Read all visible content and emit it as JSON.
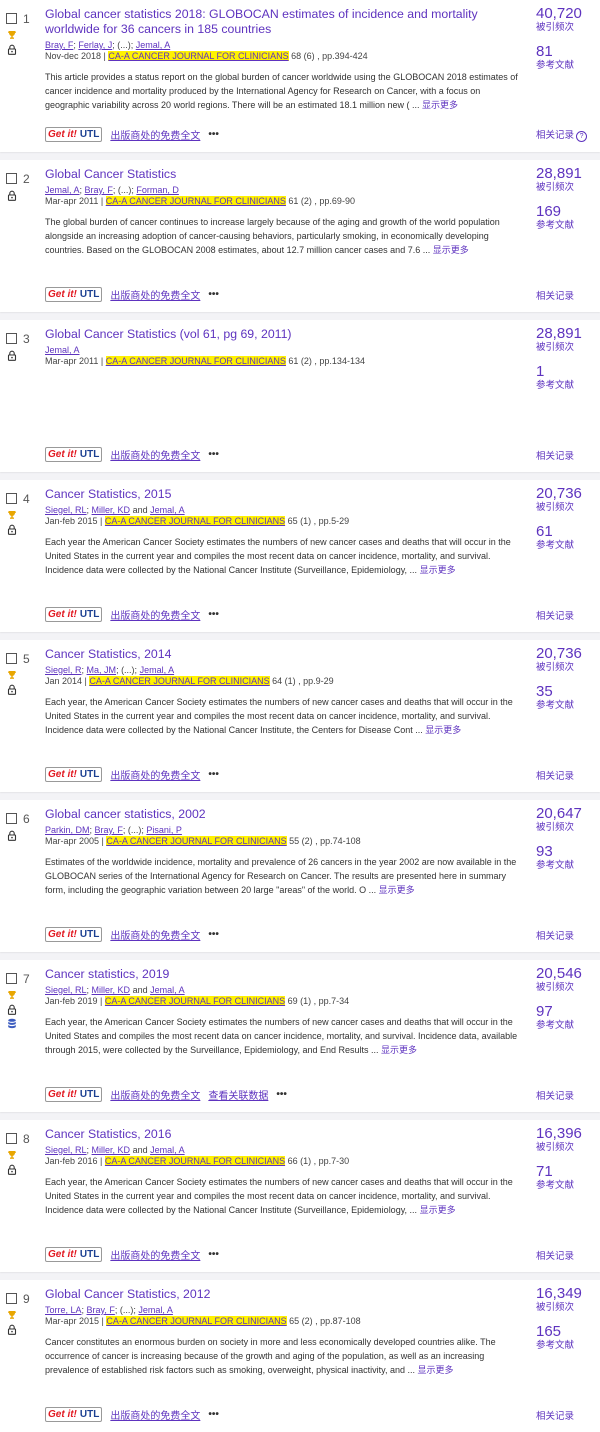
{
  "ui": {
    "more_label": "显示更多",
    "getit_g": "Get it!",
    "getit_u": "UTL",
    "fulltext_label": "出版商处的免费全文",
    "dataset_label": "查看关联数据",
    "dots": "•••",
    "cited_label": "被引频次",
    "refs_label": "参考文献",
    "related_label": "相关记录",
    "help_icon_text": "?",
    "icons": {
      "award": "trophy-icon",
      "lock": "lock-icon",
      "data": "database-icon"
    },
    "colors": {
      "link": "#5e33bf",
      "highlight": "#fff200",
      "getit_red": "#e21a22",
      "getit_blue": "#1b3f91"
    }
  },
  "records": [
    {
      "n": "1",
      "trophy": true,
      "lock": true,
      "db": false,
      "title": "Global cancer statistics 2018: GLOBOCAN estimates of incidence and mortality worldwide for 36 cancers in 185 countries",
      "authors": [
        {
          "t": "Bray, F",
          "link": true
        },
        {
          "t": "; ",
          "link": false
        },
        {
          "t": "Ferlay, J",
          "link": true
        },
        {
          "t": "; (...); ",
          "link": false
        },
        {
          "t": "Jemal, A",
          "link": true
        }
      ],
      "date": "Nov-dec 2018 | ",
      "journal": "CA-A CANCER JOURNAL FOR CLINICIANS",
      "issue": " 68 (6) , pp.394-424",
      "abstract": "This article provides a status report on the global burden of cancer worldwide using the GLOBOCAN 2018 estimates of cancer incidence and mortality produced by the International Agency for Research on Cancer, with a focus on geographic variability across 20 world regions. There will be an estimated 18.1 million new ( ...",
      "cited": "40,720",
      "refs": "81",
      "help": true,
      "dataset": false
    },
    {
      "n": "2",
      "trophy": false,
      "lock": true,
      "db": false,
      "title": "Global Cancer Statistics",
      "authors": [
        {
          "t": "Jemal, A",
          "link": true
        },
        {
          "t": "; ",
          "link": false
        },
        {
          "t": "Bray, F",
          "link": true
        },
        {
          "t": "; (...); ",
          "link": false
        },
        {
          "t": "Forman, D",
          "link": true
        }
      ],
      "date": "Mar-apr 2011 | ",
      "journal": "CA-A CANCER JOURNAL FOR CLINICIANS",
      "issue": " 61 (2) , pp.69-90",
      "abstract": "The global burden of cancer continues to increase largely because of the aging and growth of the world population alongside an increasing adoption of cancer-causing behaviors, particularly smoking, in economically developing countries. Based on the GLOBOCAN 2008 estimates, about 12.7 million cancer cases and 7.6 ...",
      "cited": "28,891",
      "refs": "169",
      "help": false,
      "dataset": false
    },
    {
      "n": "3",
      "trophy": false,
      "lock": true,
      "db": false,
      "title": "Global Cancer Statistics (vol 61, pg 69, 2011)",
      "authors": [
        {
          "t": "Jemal, A",
          "link": true
        }
      ],
      "date": "Mar-apr 2011 | ",
      "journal": "CA-A CANCER JOURNAL FOR CLINICIANS",
      "issue": " 61 (2) , pp.134-134",
      "abstract": "",
      "cited": "28,891",
      "refs": "1",
      "help": false,
      "dataset": false
    },
    {
      "n": "4",
      "trophy": true,
      "lock": true,
      "db": false,
      "title": "Cancer Statistics, 2015",
      "authors": [
        {
          "t": "Siegel, RL",
          "link": true
        },
        {
          "t": "; ",
          "link": false
        },
        {
          "t": "Miller, KD",
          "link": true
        },
        {
          "t": " and ",
          "link": false
        },
        {
          "t": "Jemal, A",
          "link": true
        }
      ],
      "date": "Jan-feb 2015 | ",
      "journal": "CA-A CANCER JOURNAL FOR CLINICIANS",
      "issue": " 65 (1) , pp.5-29",
      "abstract": "Each year the American Cancer Society estimates the numbers of new cancer cases and deaths that will occur in the United States in the current year and compiles the most recent data on cancer incidence, mortality, and survival. Incidence data were collected by the National Cancer Institute (Surveillance, Epidemiology, ...",
      "cited": "20,736",
      "refs": "61",
      "help": false,
      "dataset": false
    },
    {
      "n": "5",
      "trophy": true,
      "lock": true,
      "db": false,
      "title": "Cancer Statistics, 2014",
      "authors": [
        {
          "t": "Siegel, R",
          "link": true
        },
        {
          "t": "; ",
          "link": false
        },
        {
          "t": "Ma, JM",
          "link": true
        },
        {
          "t": "; (...); ",
          "link": false
        },
        {
          "t": "Jemal, A",
          "link": true
        }
      ],
      "date": "Jan 2014 | ",
      "journal": "CA-A CANCER JOURNAL FOR CLINICIANS",
      "issue": " 64 (1) , pp.9-29",
      "abstract": "Each year, the American Cancer Society estimates the numbers of new cancer cases and deaths that will occur in the United States in the current year and compiles the most recent data on cancer incidence, mortality, and survival. Incidence data were collected by the National Cancer Institute, the Centers for Disease Cont ...",
      "cited": "20,736",
      "refs": "35",
      "help": false,
      "dataset": false
    },
    {
      "n": "6",
      "trophy": false,
      "lock": true,
      "db": false,
      "title": "Global cancer statistics, 2002",
      "authors": [
        {
          "t": "Parkin, DM",
          "link": true
        },
        {
          "t": "; ",
          "link": false
        },
        {
          "t": "Bray, F",
          "link": true
        },
        {
          "t": "; (...); ",
          "link": false
        },
        {
          "t": "Pisani, P",
          "link": true
        }
      ],
      "date": "Mar-apr 2005 | ",
      "journal": "CA-A CANCER JOURNAL FOR CLINICIANS",
      "issue": " 55 (2) , pp.74-108",
      "abstract": "Estimates of the worldwide incidence, mortality and prevalence of 26 cancers in the year 2002 are now available in the GLOBOCAN series of the International Agency for Research on Cancer. The results are presented here in summary form, including the geographic variation between 20 large \"areas\" of the world. O ...",
      "cited": "20,647",
      "refs": "93",
      "help": false,
      "dataset": false
    },
    {
      "n": "7",
      "trophy": true,
      "lock": true,
      "db": true,
      "title": "Cancer statistics, 2019",
      "authors": [
        {
          "t": "Siegel, RL",
          "link": true
        },
        {
          "t": "; ",
          "link": false
        },
        {
          "t": "Miller, KD",
          "link": true
        },
        {
          "t": " and ",
          "link": false
        },
        {
          "t": "Jemal, A",
          "link": true
        }
      ],
      "date": "Jan-feb 2019 | ",
      "journal": "CA-A CANCER JOURNAL FOR CLINICIANS",
      "issue": " 69 (1) , pp.7-34",
      "abstract": "Each year, the American Cancer Society estimates the numbers of new cancer cases and deaths that will occur in the United States and compiles the most recent data on cancer incidence, mortality, and survival. Incidence data, available through 2015, were collected by the Surveillance, Epidemiology, and End Results ...",
      "cited": "20,546",
      "refs": "97",
      "help": false,
      "dataset": true
    },
    {
      "n": "8",
      "trophy": true,
      "lock": true,
      "db": false,
      "title": "Cancer Statistics, 2016",
      "authors": [
        {
          "t": "Siegel, RL",
          "link": true
        },
        {
          "t": "; ",
          "link": false
        },
        {
          "t": "Miller, KD",
          "link": true
        },
        {
          "t": " and ",
          "link": false
        },
        {
          "t": "Jemal, A",
          "link": true
        }
      ],
      "date": "Jan-feb 2016 | ",
      "journal": "CA-A CANCER JOURNAL FOR CLINICIANS",
      "issue": " 66 (1) , pp.7-30",
      "abstract": "Each year, the American Cancer Society estimates the numbers of new cancer cases and deaths that will occur in the United States in the current year and compiles the most recent data on cancer incidence, mortality, and survival. Incidence data were collected by the National Cancer Institute (Surveillance, Epidemiology, ...",
      "cited": "16,396",
      "refs": "71",
      "help": false,
      "dataset": false
    },
    {
      "n": "9",
      "trophy": true,
      "lock": true,
      "db": false,
      "title": "Global Cancer Statistics, 2012",
      "authors": [
        {
          "t": "Torre, LA",
          "link": true
        },
        {
          "t": "; ",
          "link": false
        },
        {
          "t": "Bray, F",
          "link": true
        },
        {
          "t": "; (...); ",
          "link": false
        },
        {
          "t": "Jemal, A",
          "link": true
        }
      ],
      "date": "Mar-apr 2015 | ",
      "journal": "CA-A CANCER JOURNAL FOR CLINICIANS",
      "issue": " 65 (2) , pp.87-108",
      "abstract": "Cancer constitutes an enormous burden on society in more and less economically developed countries alike. The occurrence of cancer is increasing because of the growth and aging of the population, as well as an increasing prevalence of established risk factors such as smoking, overweight, physical inactivity, and ...",
      "cited": "16,349",
      "refs": "165",
      "help": false,
      "dataset": false
    }
  ]
}
